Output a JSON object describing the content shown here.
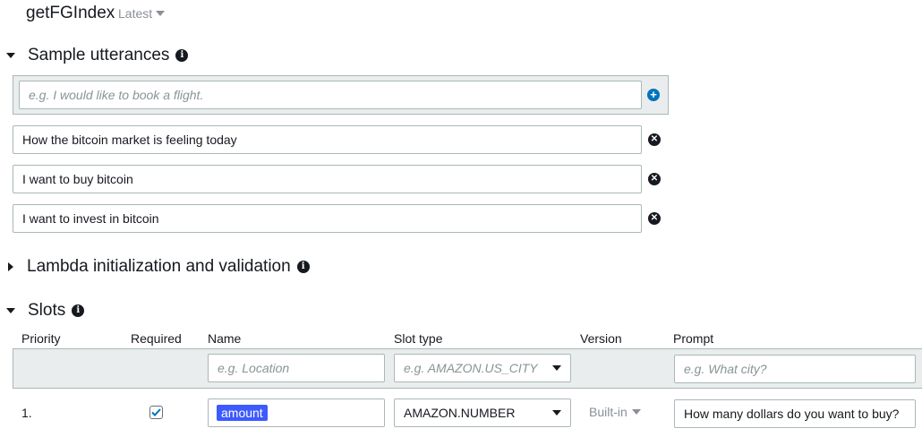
{
  "intent": {
    "name": "getFGIndex",
    "version": "Latest"
  },
  "utterances": {
    "section_title": "Sample utterances",
    "placeholder": "e.g. I would like to book a flight.",
    "items": [
      "How the bitcoin market is feeling today",
      "I want to buy bitcoin",
      "I want to invest in bitcoin"
    ]
  },
  "lambda": {
    "section_title": "Lambda initialization and validation"
  },
  "slots": {
    "section_title": "Slots",
    "columns": {
      "priority": "Priority",
      "required": "Required",
      "name": "Name",
      "slot_type": "Slot type",
      "version": "Version",
      "prompt": "Prompt"
    },
    "new_row": {
      "name_placeholder": "e.g. Location",
      "type_placeholder": "e.g. AMAZON.US_CITY",
      "prompt_placeholder": "e.g. What city?"
    },
    "rows": [
      {
        "priority": "1.",
        "required": true,
        "name": "amount",
        "slot_type": "AMAZON.NUMBER",
        "version": "Built-in",
        "prompt": "How many dollars do you want to buy?"
      }
    ]
  },
  "icons": {
    "info": "info-icon",
    "add": "add-circle-icon",
    "remove": "remove-circle-icon",
    "check": "checkmark-icon"
  },
  "colors": {
    "add_blue": "#0073bb",
    "chip_blue": "#3d5afe",
    "panel_gray": "#eaeded"
  }
}
